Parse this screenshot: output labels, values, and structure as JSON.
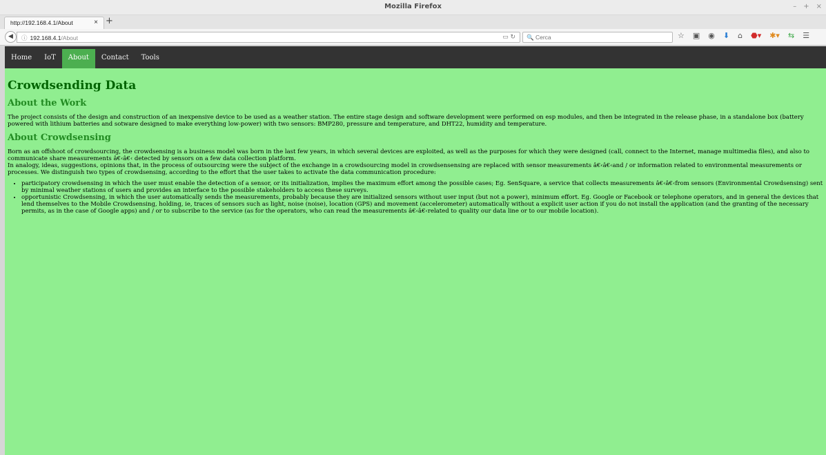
{
  "window": {
    "title": "Mozilla Firefox",
    "controls": [
      "–",
      "+",
      "×"
    ]
  },
  "tab": {
    "label": "http://192.168.4.1/About",
    "close": "×",
    "new_tab": "+"
  },
  "navbar": {
    "url_host": "192.168.4.1",
    "url_path": "/About",
    "search_placeholder": "Cerca",
    "icons": [
      "star-icon",
      "clipboard-icon",
      "pocket-icon",
      "download-icon",
      "home-icon",
      "adblock-icon",
      "extension-icon",
      "sync-icon",
      "menu-icon"
    ]
  },
  "site_nav": {
    "items": [
      "Home",
      "IoT",
      "About",
      "Contact",
      "Tools"
    ],
    "active": "About"
  },
  "page": {
    "title": "Crowdsending Data",
    "section1": {
      "heading": "About the Work",
      "text": "The project consists of the design and construction of an inexpensive device to be used as a weather station. The entire stage design and software development were performed on esp modules, and then be integrated in the release phase, in a standalone box (battery powered with lithium batteries and sotware designed to make everything low-power) with two sensors: BMP280, pressure and temperature, and DHT22, humidity and temperature."
    },
    "section2": {
      "heading": "About Crowdsensing",
      "para1": "Born as an offshoot of crowdsourcing, the crowdsensing is a business model was born in the last few years, in which several devices are exploited, as well as the purposes for which they were designed (call, connect to the Internet, manage multimedia files), and also to communicate share measurements â€‹â€‹ detected by sensors on a few data collection platform.",
      "para2": "In analogy, ideas, suggestions, opinions that, in the process of outsourcing were the subject of the exchange in a crowdsourcing model in crowdsensensing are replaced with sensor measurements â€‹â€‹and / or information related to environmental measurements or processes. We distinguish two types of crowdsensing, according to the effort that the user takes to activate the data communication procedure:",
      "bullets": [
        "participatory crowdsensing in which the user must enable the detection of a sensor, or its initialization, implies the maximum effort among the possible cases; Eg. SenSquare, a service that collects measurements â€‹â€‹from sensors (Environmental Crowdsensing) sent by minimal weather stations of users and provides an interface to the possible stakeholders to access these surveys.",
        "opportunistic Crowdsensing, in which the user automatically sends the measurements, probably because they are initialized sensors without user input (but not a power), minimum effort. Eg. Google or Facebook or telephone operators, and in general the devices that lend themselves to the Mobile Crowdsensing, holding, ie, traces of sensors such as light, noise (noise), location (GPS) and movement (accelerometer) automatically without a explicit user action if you do not install the application (and the granting of the necessary permits, as in the case of Google apps) and / or to subscribe to the service (as for the operators, who can read the measurements â€‹â€‹related to quality our data line or to our mobile location)."
      ]
    }
  }
}
